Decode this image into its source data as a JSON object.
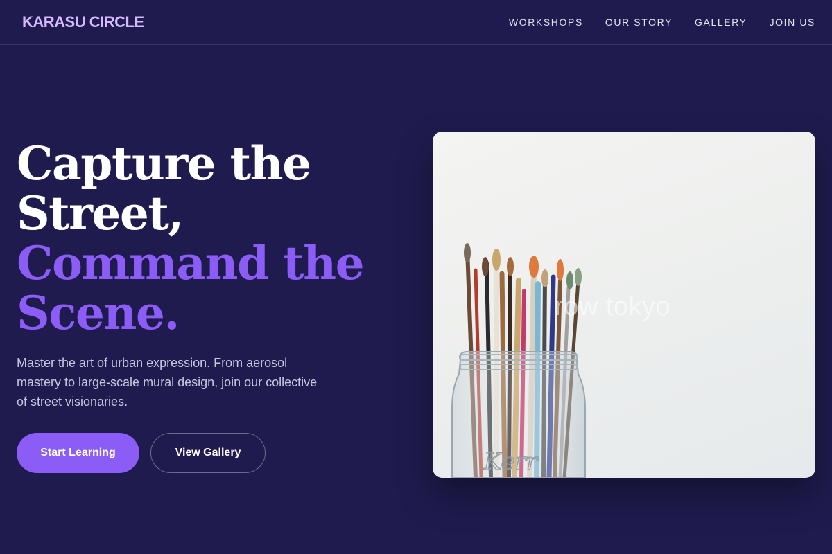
{
  "header": {
    "brand": "KARASU CIRCLE",
    "nav": [
      "WORKSHOPS",
      "OUR STORY",
      "GALLERY",
      "JOIN US"
    ]
  },
  "hero": {
    "title_line1": "Capture the",
    "title_line2": "Street,",
    "title_line3": "Command the",
    "title_line4": "Scene.",
    "lead": "Master the art of urban expression. From aerosol mastery to large-scale mural design, join our collective of street visionaries.",
    "primary_cta": "Start Learning",
    "secondary_cta": "View Gallery"
  },
  "image": {
    "watermark": "row tokyo",
    "jar_text": "Kerr"
  },
  "colors": {
    "background": "#1f1b4e",
    "accent": "#8b5cf6",
    "brand": "#d6b8ff"
  }
}
